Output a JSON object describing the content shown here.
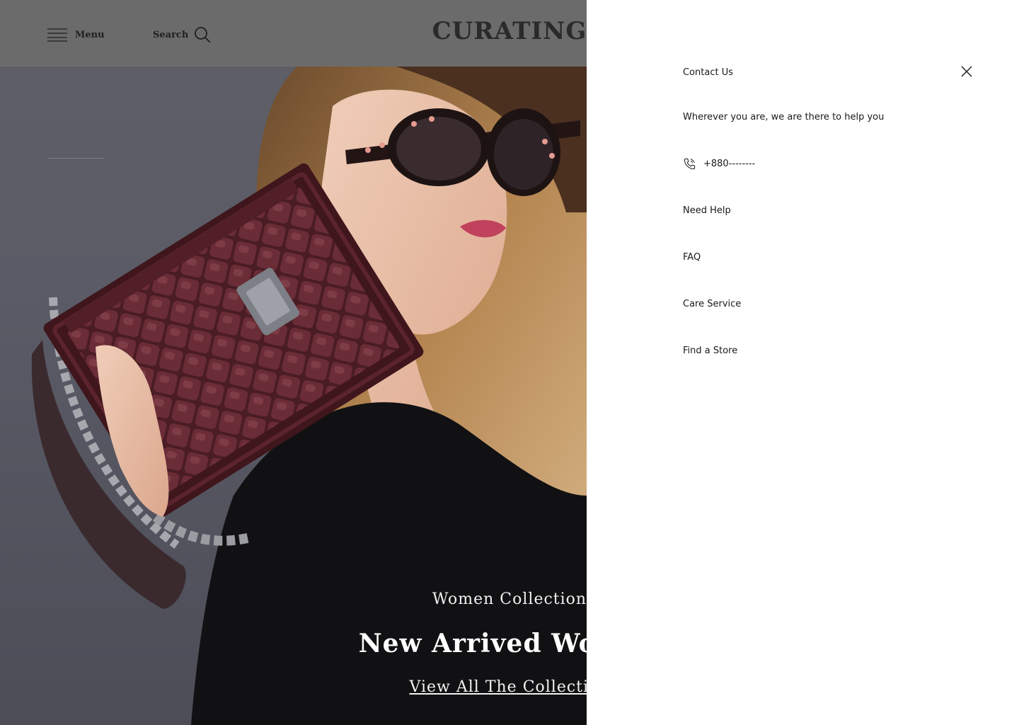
{
  "header": {
    "menu_label": "Menu",
    "search_label": "Search",
    "brand": "CURATING"
  },
  "hero": {
    "kicker": "Women Collection",
    "title": "New Arrived Woman",
    "link": "View All The Collection"
  },
  "drawer": {
    "title": "Contact Us",
    "tagline": "Wherever you are, we are there to help you",
    "phone": "+880--------",
    "links": [
      "Need Help",
      "FAQ",
      "Care Service",
      "Find a Store"
    ]
  },
  "icons": [
    "hamburger-icon",
    "search-icon",
    "close-icon",
    "phone-icon"
  ],
  "colors": {
    "header_overlay": "#6b6b6b",
    "hero_backdrop": "#5a5b66",
    "bag": "#4a1c24",
    "drawer_bg": "#ffffff",
    "text_dark": "#1a1a1a"
  }
}
